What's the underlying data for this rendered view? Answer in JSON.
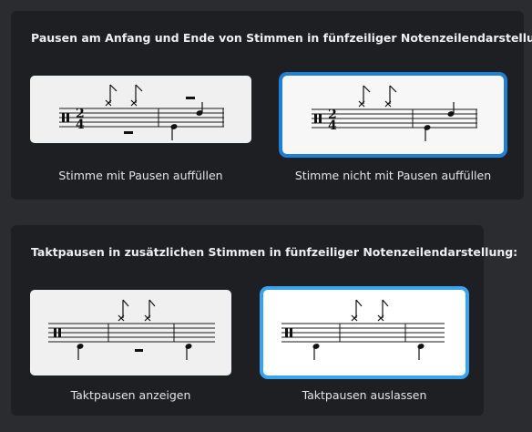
{
  "section1": {
    "title": "Pausen am Anfang und Ende von Stimmen in fünfzeiliger Notenzeilendarstellung:",
    "options": [
      {
        "caption": "Stimme mit Pausen auffüllen",
        "selected": false
      },
      {
        "caption": "Stimme nicht mit Pausen auffüllen",
        "selected": true
      }
    ]
  },
  "section2": {
    "title": "Taktpausen in zusätzlichen Stimmen in fünfzeiliger Notenzeilendarstellung:",
    "options": [
      {
        "caption": "Taktpausen anzeigen",
        "selected": false
      },
      {
        "caption": "Taktpausen auslassen",
        "selected": true
      }
    ]
  },
  "notation": {
    "time_signature_top": "2",
    "time_signature_bottom": "4"
  },
  "colors": {
    "panel": "#1e1f23",
    "background": "#2b2c30",
    "selected_border_1": "#1f7fd4",
    "selected_border_2": "#39a3f0"
  }
}
